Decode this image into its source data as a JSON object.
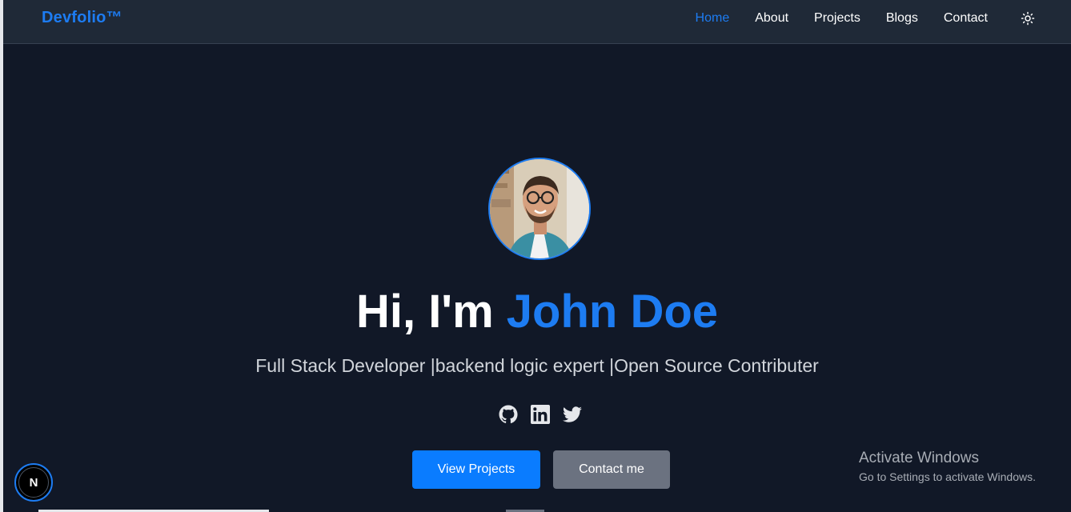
{
  "nav": {
    "brand": "Devfolio™",
    "links": [
      {
        "label": "Home",
        "active": true
      },
      {
        "label": "About",
        "active": false
      },
      {
        "label": "Projects",
        "active": false
      },
      {
        "label": "Blogs",
        "active": false
      },
      {
        "label": "Contact",
        "active": false
      }
    ],
    "theme_toggle_icon": "sun-icon"
  },
  "hero": {
    "avatar_icon": "profile-photo",
    "greeting": "Hi, I'm ",
    "name": "John Doe",
    "subtitle": "Full Stack Developer |backend logic expert |Open Source Contributer",
    "socials": [
      {
        "icon": "github-icon"
      },
      {
        "icon": "linkedin-icon"
      },
      {
        "icon": "twitter-icon"
      }
    ],
    "primary_button": "View Projects",
    "secondary_button": "Contact me"
  },
  "overlay": {
    "next_badge_letter": "N",
    "watermark_title": "Activate Windows",
    "watermark_sub": "Go to Settings to activate Windows."
  },
  "colors": {
    "background": "#111827",
    "navbar": "#1f2937",
    "accent": "#1d7cf2",
    "primary_button": "#0a7cff",
    "secondary_button": "#6b7280"
  }
}
